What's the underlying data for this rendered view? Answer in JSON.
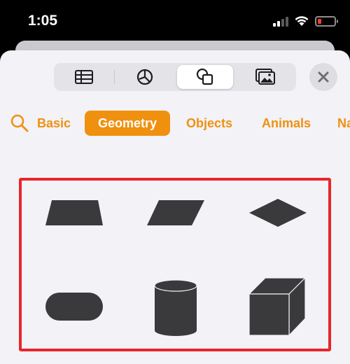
{
  "status_bar": {
    "time": "1:05",
    "battery_color": "#ff3b30"
  },
  "tabs": [
    {
      "name": "table",
      "icon": "table-icon",
      "selected": false
    },
    {
      "name": "chart",
      "icon": "pie-chart-icon",
      "selected": false
    },
    {
      "name": "shapes",
      "icon": "shapes-icon",
      "selected": true
    },
    {
      "name": "media",
      "icon": "photo-icon",
      "selected": false
    }
  ],
  "close_icon": "close-icon",
  "categories": {
    "search_icon": "search-icon",
    "items": [
      "Basic",
      "Geometry",
      "Objects",
      "Animals",
      "Na"
    ],
    "selected": "Geometry"
  },
  "accent_color": "#f0900f",
  "highlight_color": "#e8262a",
  "shapes": [
    "trapezoid",
    "parallelogram",
    "diamond",
    "rounded-rectangle",
    "cylinder",
    "cube"
  ]
}
